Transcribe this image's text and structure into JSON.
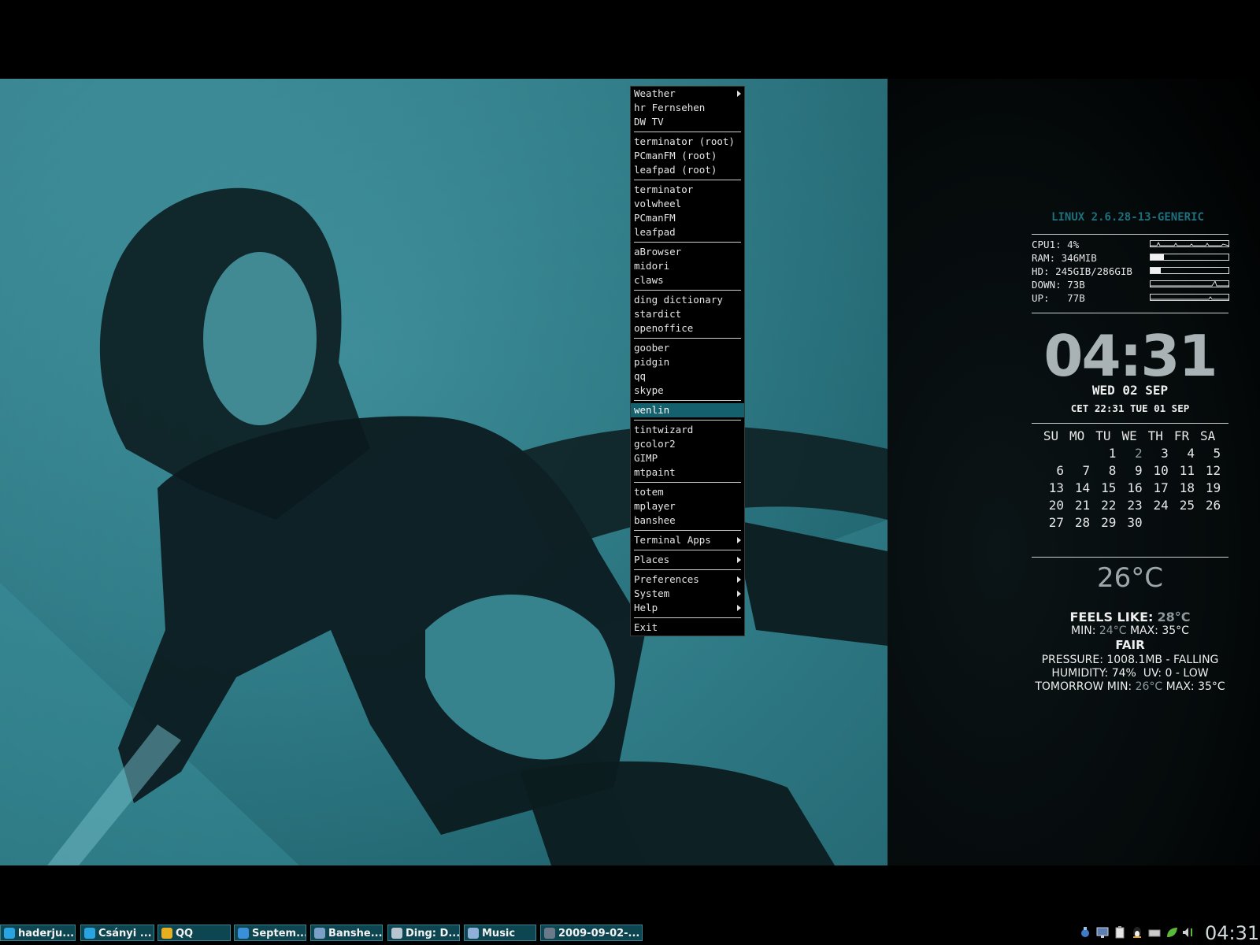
{
  "menu": {
    "items": [
      {
        "label": "Weather",
        "submenu": true
      },
      {
        "label": "hr Fernsehen"
      },
      {
        "label": "DW TV"
      },
      {
        "label": "terminator (root)"
      },
      {
        "label": "PCmanFM (root)"
      },
      {
        "label": "leafpad (root)"
      },
      {
        "label": "terminator"
      },
      {
        "label": "volwheel"
      },
      {
        "label": "PCmanFM"
      },
      {
        "label": "leafpad"
      },
      {
        "label": "aBrowser"
      },
      {
        "label": "midori"
      },
      {
        "label": "claws"
      },
      {
        "label": "ding dictionary"
      },
      {
        "label": "stardict"
      },
      {
        "label": "openoffice"
      },
      {
        "label": "goober"
      },
      {
        "label": "pidgin"
      },
      {
        "label": "qq"
      },
      {
        "label": "skype"
      },
      {
        "label": "wenlin",
        "highlighted": true
      },
      {
        "label": "tintwizard"
      },
      {
        "label": "gcolor2"
      },
      {
        "label": "GIMP"
      },
      {
        "label": "mtpaint"
      },
      {
        "label": "totem"
      },
      {
        "label": "mplayer"
      },
      {
        "label": "banshee"
      },
      {
        "label": "Terminal Apps",
        "submenu": true
      },
      {
        "label": "Places",
        "submenu": true
      },
      {
        "label": "Preferences",
        "submenu": true
      },
      {
        "label": "System",
        "submenu": true
      },
      {
        "label": "Help",
        "submenu": true
      },
      {
        "label": "Exit"
      }
    ]
  },
  "conky": {
    "kernel": "LINUX 2.6.28-13-GENERIC",
    "cpu": "CPU1: 4%",
    "ram": "RAM: 346MIB",
    "hd": "HD: 245GIB/286GIB",
    "down": "DOWN: 73B",
    "up": "UP:   77B",
    "ram_fraction": 0.17,
    "hd_fraction": 0.13,
    "clock": "04:31",
    "date": "WED 02 SEP",
    "cet": "CET 22:31 TUE 01 SEP",
    "calendar": {
      "days": [
        "SU",
        "MO",
        "TU",
        "WE",
        "TH",
        "FR",
        "SA"
      ],
      "weeks": [
        [
          "",
          "",
          "",
          "1",
          "2",
          "3",
          "4",
          "5"
        ],
        [
          "6",
          "7",
          "8",
          "9",
          "10",
          "11",
          "12"
        ],
        [
          "13",
          "14",
          "15",
          "16",
          "17",
          "18",
          "19"
        ],
        [
          "20",
          "21",
          "22",
          "23",
          "24",
          "25",
          "26"
        ],
        [
          "27",
          "28",
          "29",
          "30",
          "",
          "",
          ""
        ]
      ],
      "today": "2"
    },
    "temperature": "26°C",
    "feels_like_label": "FEELS LIKE:",
    "feels_like": "28°C",
    "min_label": "MIN:",
    "min": "24°C",
    "max_label": "MAX:",
    "max": "35°C",
    "condition": "FAIR",
    "pressure": "PRESSURE: 1008.1MB - FALLING",
    "humidity": "HUMIDITY: 74%  UV: 0 - LOW",
    "tomorrow_min_label": "TOMORROW MIN:",
    "tomorrow_min": "26°C",
    "tomorrow_max_label": "MAX:",
    "tomorrow_max": "35°C"
  },
  "taskbar": {
    "tasks": [
      {
        "label": "haderju...",
        "icon": "skype-icon",
        "color": "#2aa4e0"
      },
      {
        "label": "Csányi ...",
        "icon": "skype-icon",
        "color": "#2aa4e0"
      },
      {
        "label": "QQ",
        "icon": "qq-penguin-icon",
        "color": "#e8b020"
      },
      {
        "label": "Septem...",
        "icon": "browser-globe-icon",
        "color": "#3a8fd8"
      },
      {
        "label": "Banshe...",
        "icon": "banshee-icon",
        "color": "#7aa0c8"
      },
      {
        "label": "Ding: D...",
        "icon": "window-icon",
        "color": "#b8c4d0"
      },
      {
        "label": "Music",
        "icon": "folder-icon",
        "color": "#8fb0d8"
      },
      {
        "label": "2009-09-02-...",
        "icon": "image-viewer-icon",
        "color": "#6a7a8a"
      }
    ],
    "clock": "04:31"
  }
}
